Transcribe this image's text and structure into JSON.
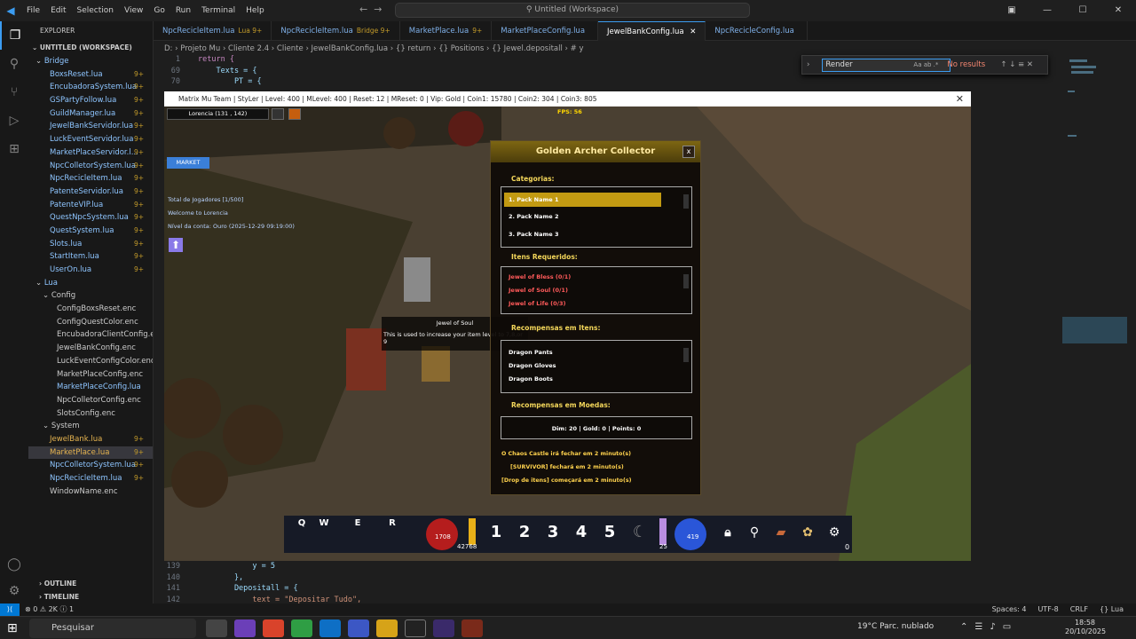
{
  "menu": [
    "File",
    "Edit",
    "Selection",
    "View",
    "Go",
    "Run",
    "Terminal",
    "Help"
  ],
  "command_center": "Untitled (Workspace)",
  "explorer": {
    "title": "EXPLORER",
    "workspace": "UNTITLED (WORKSPACE)",
    "outline": "OUTLINE",
    "timeline": "TIMELINE",
    "items": [
      {
        "label": "Bridge",
        "indent": 1,
        "folder": true,
        "badge": "",
        "color": "#8ec5ff"
      },
      {
        "label": "BoxsReset.lua",
        "indent": 2,
        "badge": "9+",
        "color": "#8ec5ff"
      },
      {
        "label": "EncubadoraSystem.lua",
        "indent": 2,
        "badge": "9+",
        "color": "#8ec5ff"
      },
      {
        "label": "GSPartyFollow.lua",
        "indent": 2,
        "badge": "9+",
        "color": "#8ec5ff"
      },
      {
        "label": "GuildManager.lua",
        "indent": 2,
        "badge": "9+",
        "color": "#8ec5ff"
      },
      {
        "label": "JewelBankServidor.lua",
        "indent": 2,
        "badge": "9+",
        "color": "#8ec5ff"
      },
      {
        "label": "LuckEventServidor.lua",
        "indent": 2,
        "badge": "9+",
        "color": "#8ec5ff"
      },
      {
        "label": "MarketPlaceServidor.l...",
        "indent": 2,
        "badge": "9+",
        "color": "#8ec5ff"
      },
      {
        "label": "NpcColletorSystem.lua",
        "indent": 2,
        "badge": "9+",
        "color": "#8ec5ff"
      },
      {
        "label": "NpcRecicleItem.lua",
        "indent": 2,
        "badge": "9+",
        "color": "#8ec5ff"
      },
      {
        "label": "PatenteServidor.lua",
        "indent": 2,
        "badge": "9+",
        "color": "#8ec5ff"
      },
      {
        "label": "PatenteVIP.lua",
        "indent": 2,
        "badge": "9+",
        "color": "#8ec5ff"
      },
      {
        "label": "QuestNpcSystem.lua",
        "indent": 2,
        "badge": "9+",
        "color": "#8ec5ff"
      },
      {
        "label": "QuestSystem.lua",
        "indent": 2,
        "badge": "9+",
        "color": "#8ec5ff"
      },
      {
        "label": "Slots.lua",
        "indent": 2,
        "badge": "9+",
        "color": "#8ec5ff"
      },
      {
        "label": "StartItem.lua",
        "indent": 2,
        "badge": "9+",
        "color": "#8ec5ff"
      },
      {
        "label": "UserOn.lua",
        "indent": 2,
        "badge": "9+",
        "color": "#8ec5ff"
      },
      {
        "label": "Lua",
        "indent": 1,
        "folder": true,
        "badge": "",
        "color": "#8ec5ff"
      },
      {
        "label": "Config",
        "indent": 2,
        "folder": true,
        "badge": "",
        "color": "#ccc"
      },
      {
        "label": "ConfigBoxsReset.enc",
        "indent": 3,
        "badge": "",
        "color": "#ccc"
      },
      {
        "label": "ConfigQuestColor.enc",
        "indent": 3,
        "badge": "",
        "color": "#ccc"
      },
      {
        "label": "EncubadoraClientConfig.e...",
        "indent": 3,
        "badge": "",
        "color": "#ccc"
      },
      {
        "label": "JewelBankConfig.enc",
        "indent": 3,
        "badge": "",
        "color": "#ccc"
      },
      {
        "label": "LuckEventConfigColor.enc",
        "indent": 3,
        "badge": "",
        "color": "#ccc"
      },
      {
        "label": "MarketPlaceConfig.enc",
        "indent": 3,
        "badge": "",
        "color": "#ccc"
      },
      {
        "label": "MarketPlaceConfig.lua",
        "indent": 3,
        "badge": "",
        "color": "#8ec5ff"
      },
      {
        "label": "NpcColletorConfig.enc",
        "indent": 3,
        "badge": "",
        "color": "#ccc"
      },
      {
        "label": "SlotsConfig.enc",
        "indent": 3,
        "badge": "",
        "color": "#ccc"
      },
      {
        "label": "System",
        "indent": 2,
        "folder": true,
        "badge": "",
        "color": "#ccc"
      },
      {
        "label": "JewelBank.lua",
        "indent": 2,
        "badge": "9+",
        "color": "#e6b450"
      },
      {
        "label": "MarketPlace.lua",
        "indent": 2,
        "badge": "9+",
        "color": "#e6b450",
        "selected": true
      },
      {
        "label": "NpcColletorSystem.lua",
        "indent": 2,
        "badge": "9+",
        "color": "#8ec5ff"
      },
      {
        "label": "NpcRecicleItem.lua",
        "indent": 2,
        "badge": "9+",
        "color": "#8ec5ff"
      },
      {
        "label": "WindowName.enc",
        "indent": 2,
        "badge": "",
        "color": "#ccc"
      }
    ]
  },
  "tabs": [
    {
      "label": "NpcRecicleItem.lua",
      "suffix": "Lua 9+",
      "active": false
    },
    {
      "label": "NpcRecicleItem.lua",
      "suffix": "Bridge 9+",
      "active": false
    },
    {
      "label": "MarketPlace.lua",
      "suffix": "9+",
      "active": false
    },
    {
      "label": "MarketPlaceConfig.lua",
      "suffix": "",
      "active": false
    },
    {
      "label": "JewelBankConfig.lua",
      "suffix": "",
      "active": true
    },
    {
      "label": "NpcRecicleConfig.lua",
      "suffix": "",
      "active": false
    }
  ],
  "breadcrumb": "D: › Projeto Mu › Cliente 2.4 › Cliente › JewelBankConfig.lua › {} return › {} Positions › {} Jewel.depositall › # y",
  "code_top": [
    {
      "n": "1",
      "t": "return {"
    },
    {
      "n": "69",
      "t": "    Texts = {"
    },
    {
      "n": "70",
      "t": "        PT = {"
    }
  ],
  "code_bottom": [
    {
      "n": "139",
      "t": "            y = 5"
    },
    {
      "n": "140",
      "t": "        },"
    },
    {
      "n": "141",
      "t": "        Depositall = {"
    },
    {
      "n": "142",
      "t": "            text = \"Depositar Tudo\","
    }
  ],
  "find": {
    "value": "Render",
    "result": "No results"
  },
  "status": {
    "left": "⊗ 0  ⚠ 2K  ⓘ 1",
    "right": [
      "Spaces: 4",
      "UTF-8",
      "CRLF",
      "{} Lua"
    ]
  },
  "taskbar": {
    "search": "Pesquisar",
    "weather": "19°C  Parc. nublado",
    "time": "18:58",
    "date": "20/10/2025"
  },
  "game": {
    "title": "Matrix Mu Team | StyLer | Level: 400 | MLevel: 400 | Reset: 12 | MReset: 0 | Vip: Gold | Coin1: 15780 | Coin2: 304 | Coin3: 805",
    "location": "Lorencia (131 , 142)",
    "fps": "FPS: 56",
    "market": "MARKET",
    "chat": [
      "Total de Jogadores [1/500]",
      "Welcome to Lorencia",
      "Nível da conta: Ouro (2025-12-29 09:19:00)"
    ],
    "tooltip": {
      "title": "Jewel of Soul",
      "desc": "This is used to increase your item level to 7,8,or 9"
    },
    "panel": {
      "title": "Golden Archer Collector",
      "close": "x",
      "sec_categories": "Categorias:",
      "categories": [
        "1. Pack Name 1",
        "2. Pack Name 2",
        "3. Pack Name 3"
      ],
      "sec_required": "Itens Requeridos:",
      "required": [
        "Jewel of Bless (0/1)",
        "Jewel of Soul (0/1)",
        "Jewel of Life (0/3)"
      ],
      "sec_rewards_items": "Recompensas em Itens:",
      "rewards": [
        "Dragon Pants",
        "Dragon Gloves",
        "Dragon Boots"
      ],
      "sec_rewards_coins": "Recompensas em Moedas:",
      "coins": "Dim: 20 | Gold: 0 | Points: 0",
      "messages": [
        "O Chaos Castle irá fechar em 2 minuto(s)",
        "[SURVIVOR] fechará em 2 minuto(s)",
        "[Drop de itens] começará em 2 minuto(s)"
      ]
    },
    "hotbar": {
      "keys": [
        "Q",
        "W",
        "E",
        "R"
      ],
      "hp": "1708",
      "hp2": "42768",
      "slots": [
        "1",
        "2",
        "3",
        "4",
        "5"
      ],
      "sd": "25",
      "mana": "419",
      "zero": "0"
    }
  }
}
